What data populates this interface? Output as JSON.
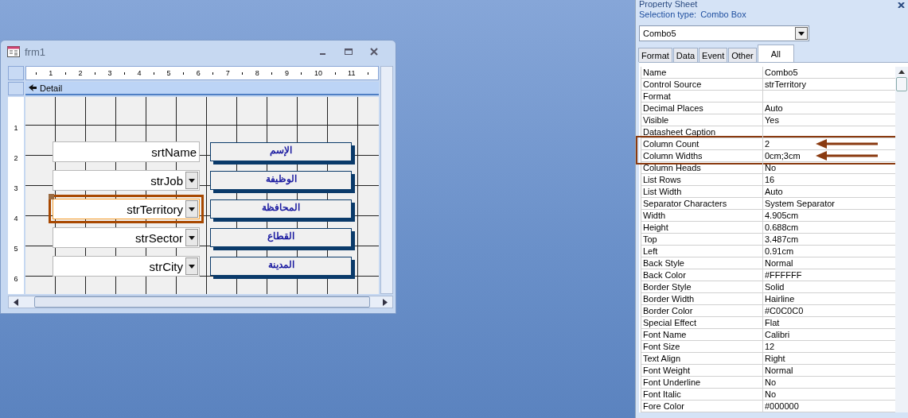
{
  "form_window": {
    "title": "frm1",
    "ruler_h": [
      "1",
      "2",
      "3",
      "4",
      "5",
      "6",
      "7",
      "8",
      "9",
      "10",
      "11"
    ],
    "ruler_v": [
      "1",
      "2",
      "3",
      "4",
      "5",
      "6"
    ],
    "section": "Detail",
    "controls": [
      {
        "kind": "textbox",
        "value": "srtName",
        "label": "الإسم",
        "selected": false
      },
      {
        "kind": "combo",
        "value": "strJob",
        "label": "الوظيفة",
        "selected": false
      },
      {
        "kind": "combo",
        "value": "strTerritory",
        "label": "المحافظة",
        "selected": true
      },
      {
        "kind": "combo",
        "value": "strSector",
        "label": "القطاع",
        "selected": false
      },
      {
        "kind": "combo",
        "value": "strCity",
        "label": "المدينة",
        "selected": false
      }
    ]
  },
  "property_sheet": {
    "title": "Property Sheet",
    "selection_type_label": "Selection type:",
    "selection_type": "Combo Box",
    "object": "Combo5",
    "tabs": [
      {
        "label": "Format",
        "selected": false
      },
      {
        "label": "Data",
        "selected": false
      },
      {
        "label": "Event",
        "selected": false
      },
      {
        "label": "Other",
        "selected": false
      },
      {
        "label": "All",
        "selected": true
      }
    ],
    "properties": [
      {
        "name": "Name",
        "value": "Combo5",
        "highlighted": false
      },
      {
        "name": "Control Source",
        "value": "strTerritory",
        "highlighted": false
      },
      {
        "name": "Format",
        "highlighted": false
      },
      {
        "name": "Decimal Places",
        "value": "Auto",
        "highlighted": false
      },
      {
        "name": "Visible",
        "value": "Yes",
        "highlighted": false
      },
      {
        "name": "Datasheet Caption",
        "highlighted": false
      },
      {
        "name": "Column Count",
        "value": "2",
        "highlighted": true
      },
      {
        "name": "Column Widths",
        "value": "0cm;3cm",
        "highlighted": true
      },
      {
        "name": "Column Heads",
        "value": "No",
        "highlighted": false
      },
      {
        "name": "List Rows",
        "value": "16",
        "highlighted": false
      },
      {
        "name": "List Width",
        "value": "Auto",
        "highlighted": false
      },
      {
        "name": "Separator Characters",
        "value": "System Separator",
        "highlighted": false
      },
      {
        "name": "Width",
        "value": "4.905cm",
        "highlighted": false
      },
      {
        "name": "Height",
        "value": "0.688cm",
        "highlighted": false
      },
      {
        "name": "Top",
        "value": "3.487cm",
        "highlighted": false
      },
      {
        "name": "Left",
        "value": "0.91cm",
        "highlighted": false
      },
      {
        "name": "Back Style",
        "value": "Normal",
        "highlighted": false
      },
      {
        "name": "Back Color",
        "value": "#FFFFFF",
        "highlighted": false
      },
      {
        "name": "Border Style",
        "value": "Solid",
        "highlighted": false
      },
      {
        "name": "Border Width",
        "value": "Hairline",
        "highlighted": false
      },
      {
        "name": "Border Color",
        "value": "#C0C0C0",
        "highlighted": false
      },
      {
        "name": "Special Effect",
        "value": "Flat",
        "highlighted": false
      },
      {
        "name": "Font Name",
        "value": "Calibri",
        "highlighted": false
      },
      {
        "name": "Font Size",
        "value": "12",
        "highlighted": false
      },
      {
        "name": "Text Align",
        "value": "Right",
        "highlighted": false
      },
      {
        "name": "Font Weight",
        "value": "Normal",
        "highlighted": false
      },
      {
        "name": "Font Underline",
        "value": "No",
        "highlighted": false
      },
      {
        "name": "Font Italic",
        "value": "No",
        "highlighted": false
      },
      {
        "name": "Fore Color",
        "value": "#000000",
        "highlighted": false
      }
    ]
  }
}
